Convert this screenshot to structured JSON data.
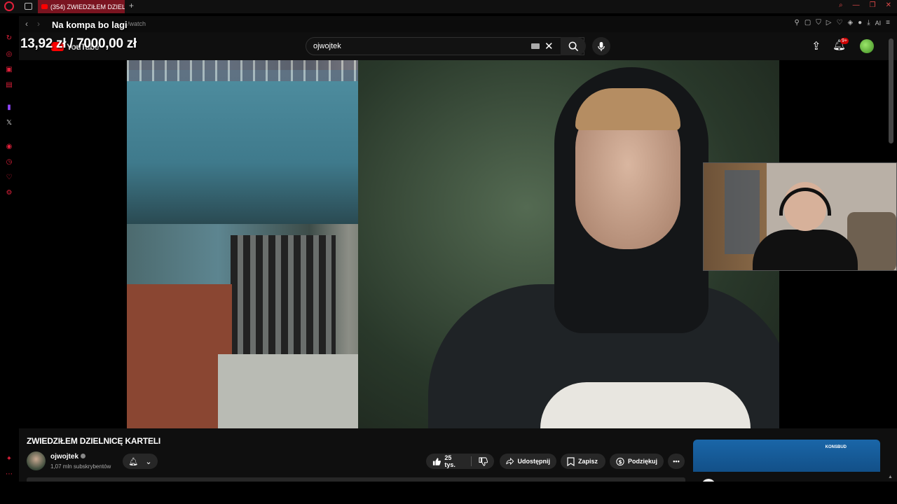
{
  "browser": {
    "tab_title": "(354) ZWIEDZIŁEM DZIEL",
    "new_tab_label": "+",
    "url": "/watch",
    "ai_label": "AI",
    "back_glyph": "‹",
    "forward_glyph": "›"
  },
  "stream_overlay": {
    "line1": "Na kompa bo lagi",
    "line2": "13,92 zł / 7000,00 zł"
  },
  "youtube": {
    "logo_text": "YouTube",
    "search_value": "ojwojtek",
    "notification_badge": "9+",
    "video_title": "ZWIEDZIŁEM DZIELNICĘ KARTELI",
    "channel_name": "ojwojtek",
    "subscribers": "1,07 mln subskrybentów",
    "like_count": "25 tys.",
    "share_label": "Udostępnij",
    "save_label": "Zapisz",
    "thanks_label": "Podziękuj",
    "more_label": "•••",
    "side_card_logo_text": "KONSBUD"
  },
  "colors": {
    "accent": "#e0203a",
    "youtube_red": "#ff0000",
    "background": "#0f0f0f"
  },
  "icons": [
    "opera-icon",
    "search-icon",
    "mic-icon",
    "upload-icon",
    "bell-icon",
    "like-icon",
    "dislike-icon",
    "share-icon",
    "save-icon",
    "thanks-icon",
    "x-icon",
    "twitch-icon"
  ]
}
